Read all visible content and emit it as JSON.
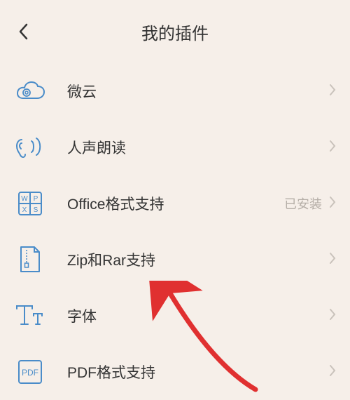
{
  "header": {
    "title": "我的插件"
  },
  "items": [
    {
      "id": "weiyun",
      "label": "微云",
      "status": ""
    },
    {
      "id": "voice-read",
      "label": "人声朗读",
      "status": ""
    },
    {
      "id": "office",
      "label": "Office格式支持",
      "status": "已安装"
    },
    {
      "id": "zip-rar",
      "label": "Zip和Rar支持",
      "status": ""
    },
    {
      "id": "fonts",
      "label": "字体",
      "status": ""
    },
    {
      "id": "pdf",
      "label": "PDF格式支持",
      "status": ""
    }
  ],
  "colors": {
    "iconStroke": "#4a8cc9",
    "chevron": "#c9c2bb",
    "arrow": "#e03030"
  }
}
